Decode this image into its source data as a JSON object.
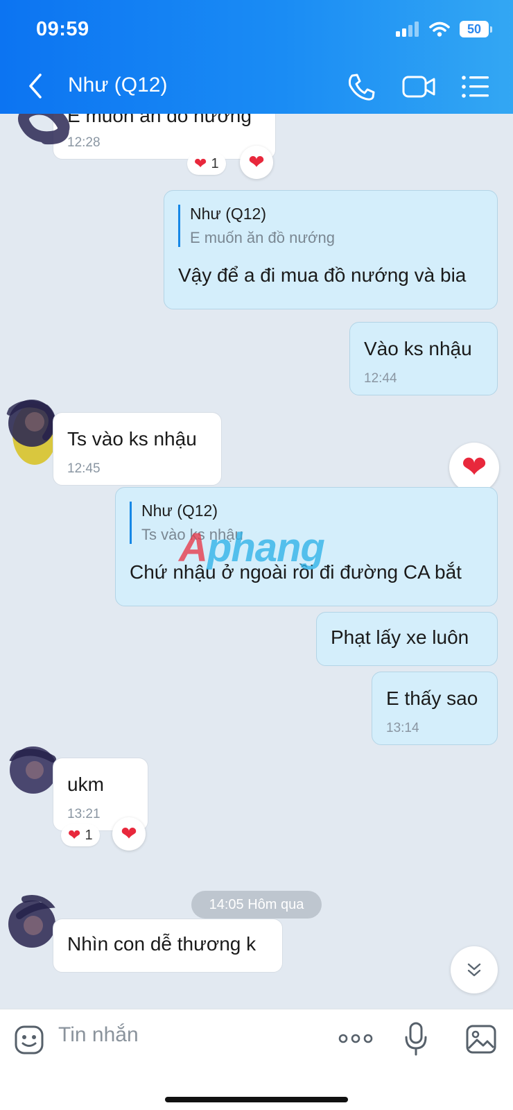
{
  "status_bar": {
    "time": "09:59",
    "battery": "50"
  },
  "header": {
    "title": "Như (Q12)",
    "back_icon": "chevron-left-icon",
    "call_icon": "phone-icon",
    "video_icon": "video-camera-icon",
    "menu_icon": "list-icon"
  },
  "colors": {
    "header_from": "#0c74f2",
    "header_to": "#33a7f3",
    "chat_bg": "#e2e9f1",
    "outgoing_bubble": "#d4eefb",
    "incoming_bubble": "#ffffff",
    "accent": "#1587e6"
  },
  "messages": [
    {
      "text": "E muốn ăn đồ nướng",
      "time": "12:28",
      "reaction_count": "1"
    },
    {
      "quote_name": "Như (Q12)",
      "quote_text": "E muốn ăn đồ nướng",
      "text": "Vậy để a đi mua đồ nướng và bia"
    },
    {
      "text": "Vào ks nhậu",
      "time": "12:44"
    },
    {
      "text": "Ts vào ks nhậu",
      "time": "12:45"
    },
    {
      "quote_name": "Như (Q12)",
      "quote_text": "Ts vào ks nhậu",
      "text": "Chứ nhậu ở ngoài rồi đi đường CA bắt"
    },
    {
      "text": "Phạt lấy xe luôn"
    },
    {
      "text": "E thấy sao",
      "time": "13:14"
    },
    {
      "text": "ukm",
      "time": "13:21",
      "reaction_count": "1"
    },
    {
      "text": "Nhìn con dễ thương k"
    }
  ],
  "date_separator": "14:05 Hôm qua",
  "watermark": {
    "first": "A",
    "rest": "phang"
  },
  "input": {
    "placeholder": "Tin nhắn",
    "sticker_icon": "sticker-icon",
    "more_icon": "more-icon",
    "mic_icon": "microphone-icon",
    "image_icon": "image-icon"
  }
}
